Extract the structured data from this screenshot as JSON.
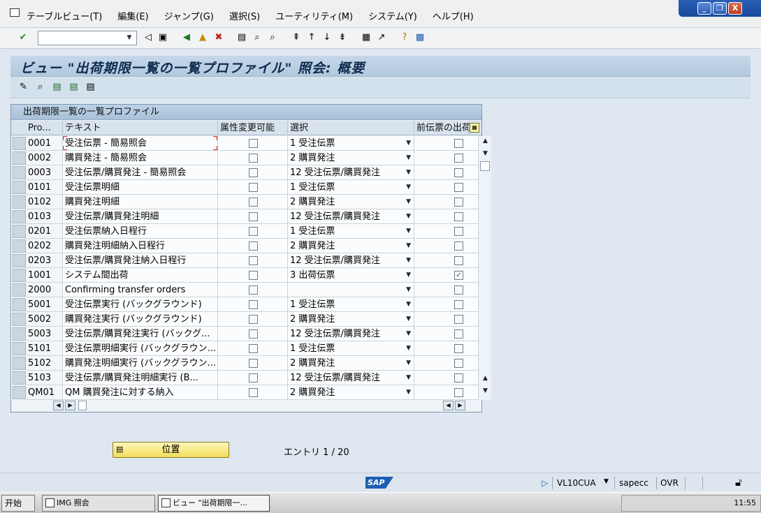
{
  "menu": {
    "items": [
      "テーブルビュー(T)",
      "編集(E)",
      "ジャンプ(G)",
      "選択(S)",
      "ユーティリティ(M)",
      "システム(Y)",
      "ヘルプ(H)"
    ]
  },
  "window_controls": {
    "minimize": "_",
    "restore": "❐",
    "close": "X"
  },
  "toolbar": {
    "command_value": ""
  },
  "title": "ビュー \"出荷期限一覧の一覧プロファイル\" 照会: 概要",
  "table": {
    "title": "出荷期限一覧の一覧プロファイル",
    "headers": {
      "code": "Pro...",
      "text": "テキスト",
      "chk1": "属性変更可能",
      "sel": "選択",
      "chk2": "前伝票の出荷"
    },
    "rows": [
      {
        "code": "0001",
        "text": "受注伝票 - 簡易照会",
        "chk1": false,
        "sel": "1 受注伝票",
        "chk2": false
      },
      {
        "code": "0002",
        "text": "購買発注 - 簡易照会",
        "chk1": false,
        "sel": "2 購買発注",
        "chk2": false
      },
      {
        "code": "0003",
        "text": "受注伝票/購買発注 - 簡易照会",
        "chk1": false,
        "sel": "12 受注伝票/購買発注",
        "chk2": false
      },
      {
        "code": "0101",
        "text": "受注伝票明細",
        "chk1": false,
        "sel": "1 受注伝票",
        "chk2": false
      },
      {
        "code": "0102",
        "text": "購買発注明細",
        "chk1": false,
        "sel": "2 購買発注",
        "chk2": false
      },
      {
        "code": "0103",
        "text": "受注伝票/購買発注明細",
        "chk1": false,
        "sel": "12 受注伝票/購買発注",
        "chk2": false
      },
      {
        "code": "0201",
        "text": "受注伝票納入日程行",
        "chk1": false,
        "sel": "1 受注伝票",
        "chk2": false
      },
      {
        "code": "0202",
        "text": "購買発注明細納入日程行",
        "chk1": false,
        "sel": "2 購買発注",
        "chk2": false
      },
      {
        "code": "0203",
        "text": "受注伝票/購買発注納入日程行",
        "chk1": false,
        "sel": "12 受注伝票/購買発注",
        "chk2": false
      },
      {
        "code": "1001",
        "text": "システム間出荷",
        "chk1": false,
        "sel": "3 出荷伝票",
        "chk2": true
      },
      {
        "code": "2000",
        "text": "Confirming transfer orders",
        "chk1": false,
        "sel": "",
        "chk2": false
      },
      {
        "code": "5001",
        "text": "受注伝票実行 (バックグラウンド)",
        "chk1": false,
        "sel": "1 受注伝票",
        "chk2": false
      },
      {
        "code": "5002",
        "text": "購買発注実行 (バックグラウンド)",
        "chk1": false,
        "sel": "2 購買発注",
        "chk2": false
      },
      {
        "code": "5003",
        "text": "受注伝票/購買発注実行 (バックグ...",
        "chk1": false,
        "sel": "12 受注伝票/購買発注",
        "chk2": false
      },
      {
        "code": "5101",
        "text": "受注伝票明細実行 (バックグラウン...",
        "chk1": false,
        "sel": "1 受注伝票",
        "chk2": false
      },
      {
        "code": "5102",
        "text": "購買発注明細実行 (バックグラウン...",
        "chk1": false,
        "sel": "2 購買発注",
        "chk2": false
      },
      {
        "code": "5103",
        "text": "受注伝票/購買発注明細実行 (B...",
        "chk1": false,
        "sel": "12 受注伝票/購買発注",
        "chk2": false
      },
      {
        "code": "QM01",
        "text": "QM 購買発注に対する納入",
        "chk1": false,
        "sel": "2 購買発注",
        "chk2": false
      }
    ]
  },
  "position_button": {
    "label": "位置"
  },
  "entry": "エントリ 1 / 20",
  "status": {
    "transaction": "VL10CUA",
    "server": "sapecc",
    "mode": "OVR",
    "logo": "SAP"
  },
  "taskbar": {
    "start": "开始",
    "items": [
      "IMG 照会",
      "ビュー \"出荷期限一..."
    ],
    "time": "11:55"
  },
  "colors": {
    "accent": "#1d5fb3",
    "title_bg": "#c5d8ea",
    "button_yellow": "#f2dd5c"
  }
}
